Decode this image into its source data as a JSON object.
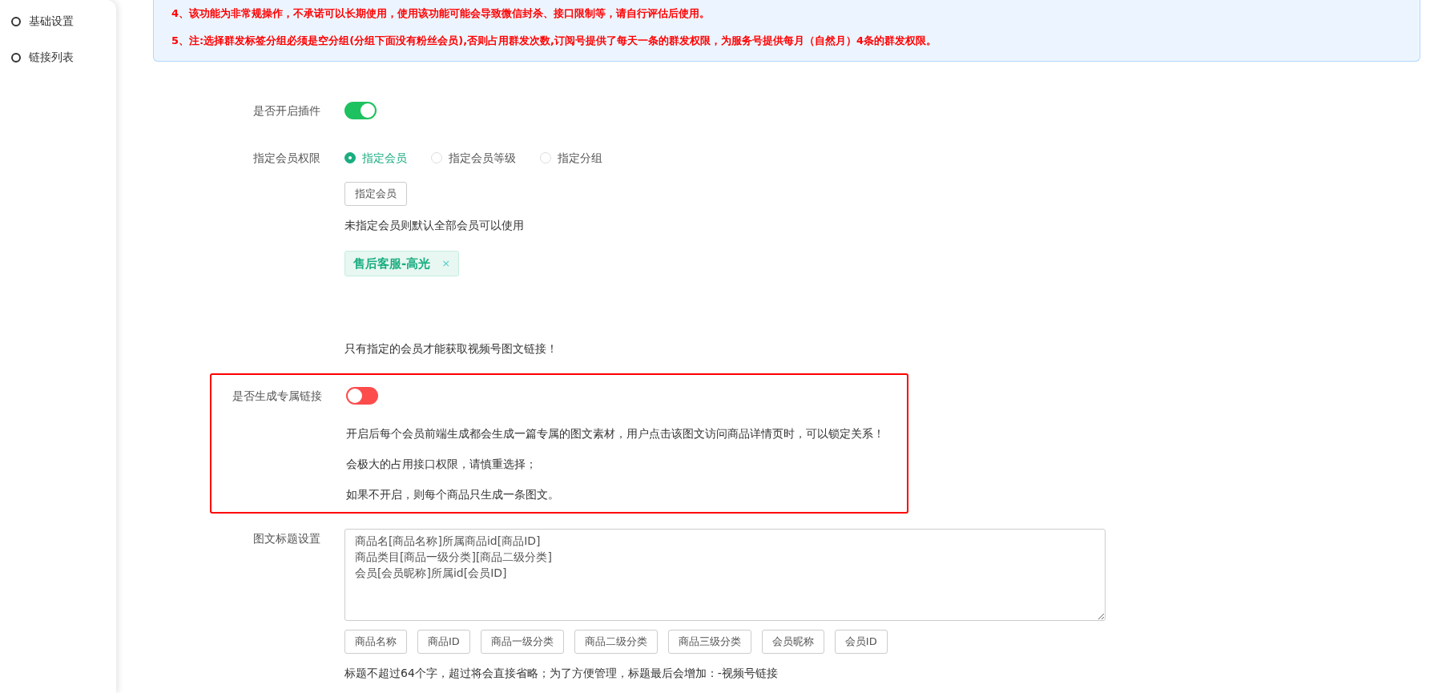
{
  "sidebar": {
    "items": [
      {
        "label": "基础设置"
      },
      {
        "label": "链接列表"
      }
    ]
  },
  "notice": {
    "lines": [
      {
        "text": "4、该功能为非常规操作，不承诺可以长期使用，使用该功能可能会导致微信封杀、接口限制等，请自行评估后使用。"
      },
      {
        "text": "5、注:选择群发标签分组必须是空分组(分组下面没有粉丝会员),否则占用群发次数,订阅号提供了每天一条的群发权限，为服务号提供每月（自然月）4条的群发权限。"
      }
    ]
  },
  "form": {
    "rows": [
      {
        "kind": "switch",
        "label": "是否开启插件",
        "on": true,
        "highlighted": false
      },
      {
        "kind": "member",
        "label": "指定会员权限",
        "highlighted": false,
        "options": [
          {
            "label": "指定会员",
            "selected": true
          },
          {
            "label": "指定会员等级",
            "selected": false
          },
          {
            "label": "指定分组",
            "selected": false
          }
        ],
        "button": "指定会员",
        "hint": "未指定会员则默认全部会员可以使用",
        "tags": [
          {
            "label": "售后客服-高光",
            "close": "×"
          }
        ],
        "note": "只有指定的会员才能获取视频号图文链接！"
      },
      {
        "kind": "switch",
        "label": "是否生成专属链接",
        "on": false,
        "highlighted": true,
        "notes": [
          "开启后每个会员前端生成都会生成一篇专属的图文素材，用户点击该图文访问商品详情页时，可以锁定关系！",
          "会极大的占用接口权限，请慎重选择；",
          "如果不开启，则每个商品只生成一条图文。"
        ]
      },
      {
        "kind": "textarea",
        "label": "图文标题设置",
        "highlighted": false,
        "value": "商品名[商品名称]所属商品id[商品ID]\n商品类目[商品一级分类][商品二级分类]\n会员[会员昵称]所属id[会员ID]",
        "chips": [
          "商品名称",
          "商品ID",
          "商品一级分类",
          "商品二级分类",
          "商品三级分类",
          "会员昵称",
          "会员ID"
        ],
        "hint": "标题不超过64个字，超过将会直接省略；为了方便管理，标题最后会增加：-视频号链接"
      }
    ]
  }
}
